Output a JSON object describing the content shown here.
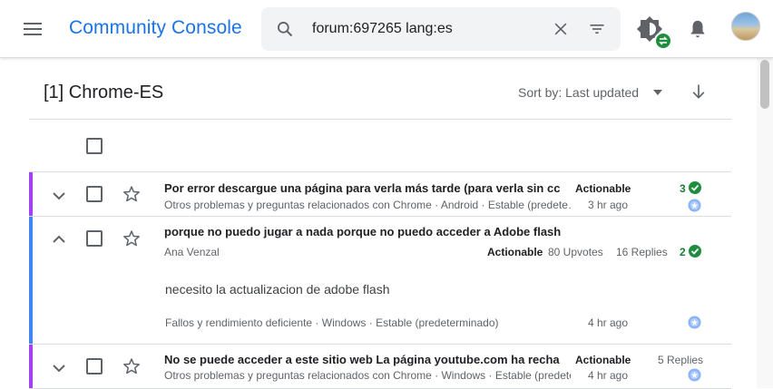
{
  "app": {
    "title": "Community Console"
  },
  "search": {
    "query": "forum:697265 lang:es"
  },
  "list": {
    "title": "[1] Chrome-ES",
    "sort_label": "Sort by: Last updated"
  },
  "threads": [
    {
      "title": "Por error descargue una página para verla más tarde (para verla sin cc",
      "subtitle": "Otros problemas y preguntas relacionados con Chrome · Android · Estable (predete…",
      "status": "Actionable",
      "time": "3 hr ago",
      "count": "3",
      "accent": "#a142f4"
    },
    {
      "title": "porque no puedo jugar a nada porque no puedo acceder a Adobe flash",
      "author": "Ana Venzal",
      "status": "Actionable",
      "upvotes": "80 Upvotes",
      "replies": "16 Replies",
      "count": "2",
      "body": "necesito la actualizacion de adobe flash",
      "subtitle": "Fallos y rendimiento deficiente · Windows · Estable (predeterminado)",
      "time": "4 hr ago",
      "accent": "#4285f4"
    },
    {
      "title": "No se puede acceder a este sitio web La página youtube.com ha recha",
      "subtitle": "Otros problemas y preguntas relacionados con Chrome · Windows · Estable (predete…",
      "status": "Actionable",
      "time": "4 hr ago",
      "replies": "5 Replies",
      "accent": "#a142f4"
    }
  ]
}
